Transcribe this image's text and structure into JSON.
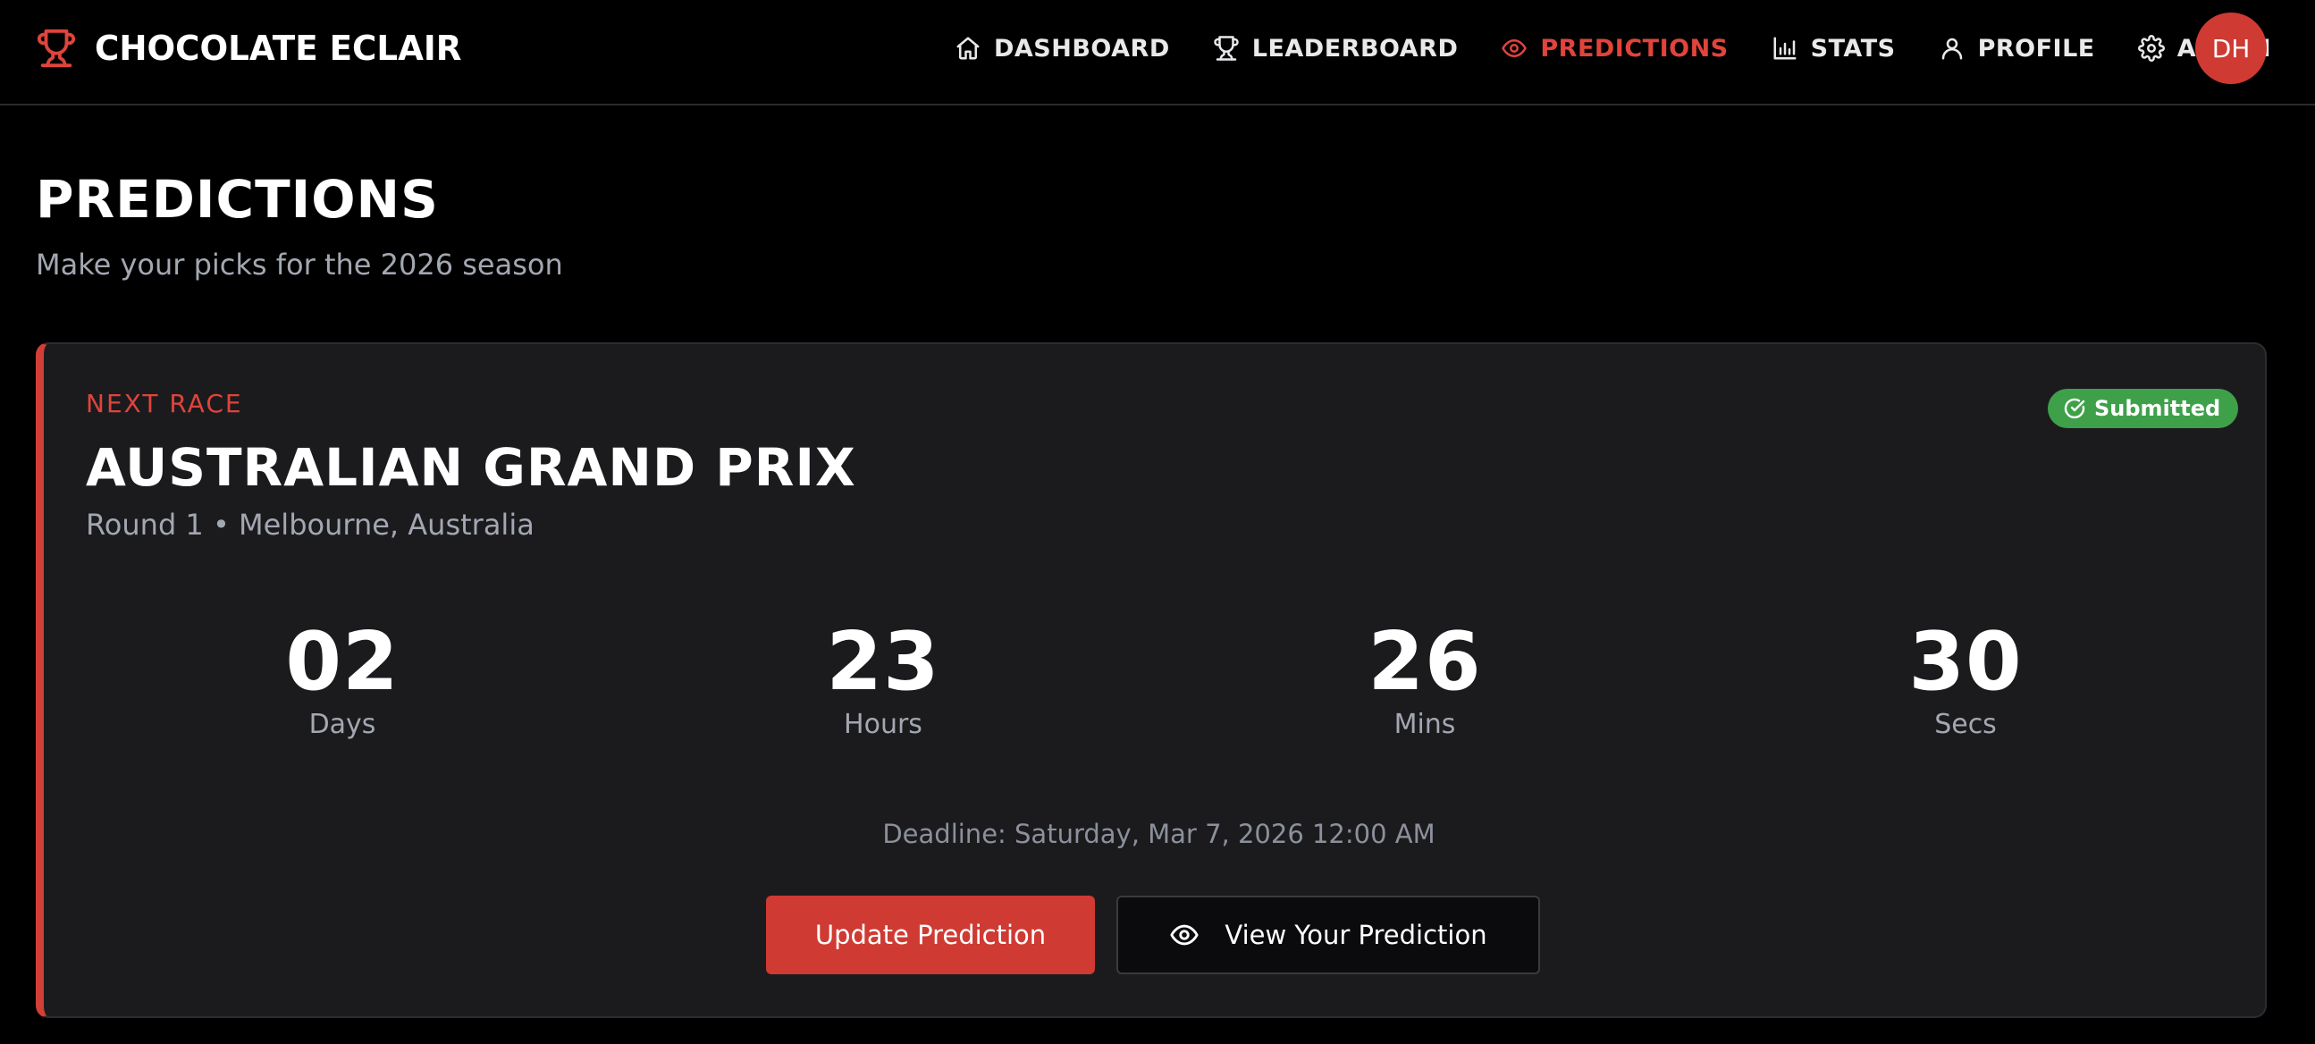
{
  "app": {
    "name": "CHOCOLATE ECLAIR",
    "logo_icon": "trophy-icon",
    "accent_color": "#d23f36"
  },
  "nav": {
    "items": [
      {
        "label": "DASHBOARD",
        "icon": "home-icon",
        "active": false
      },
      {
        "label": "LEADERBOARD",
        "icon": "trophy-icon",
        "active": false
      },
      {
        "label": "PREDICTIONS",
        "icon": "eye-icon",
        "active": true
      },
      {
        "label": "STATS",
        "icon": "bar-chart-icon",
        "active": false
      },
      {
        "label": "PROFILE",
        "icon": "user-icon",
        "active": false
      },
      {
        "label": "ADMIN",
        "icon": "gear-icon",
        "active": false
      }
    ],
    "avatar_initials": "DH"
  },
  "page": {
    "title": "PREDICTIONS",
    "subtitle": "Make your picks for the 2026 season"
  },
  "race_card": {
    "eyebrow": "NEXT RACE",
    "title": "AUSTRALIAN GRAND PRIX",
    "meta": "Round 1 • Melbourne, Australia",
    "status": {
      "label": "Submitted",
      "icon": "check-circle-icon",
      "color": "#3fa04a"
    },
    "countdown": [
      {
        "value": "02",
        "unit": "Days"
      },
      {
        "value": "23",
        "unit": "Hours"
      },
      {
        "value": "26",
        "unit": "Mins"
      },
      {
        "value": "30",
        "unit": "Secs"
      }
    ],
    "deadline": "Deadline: Saturday, Mar 7, 2026 12:00 AM",
    "primary_button": "Update Prediction",
    "secondary_button": "View Your Prediction",
    "secondary_button_icon": "eye-icon"
  }
}
